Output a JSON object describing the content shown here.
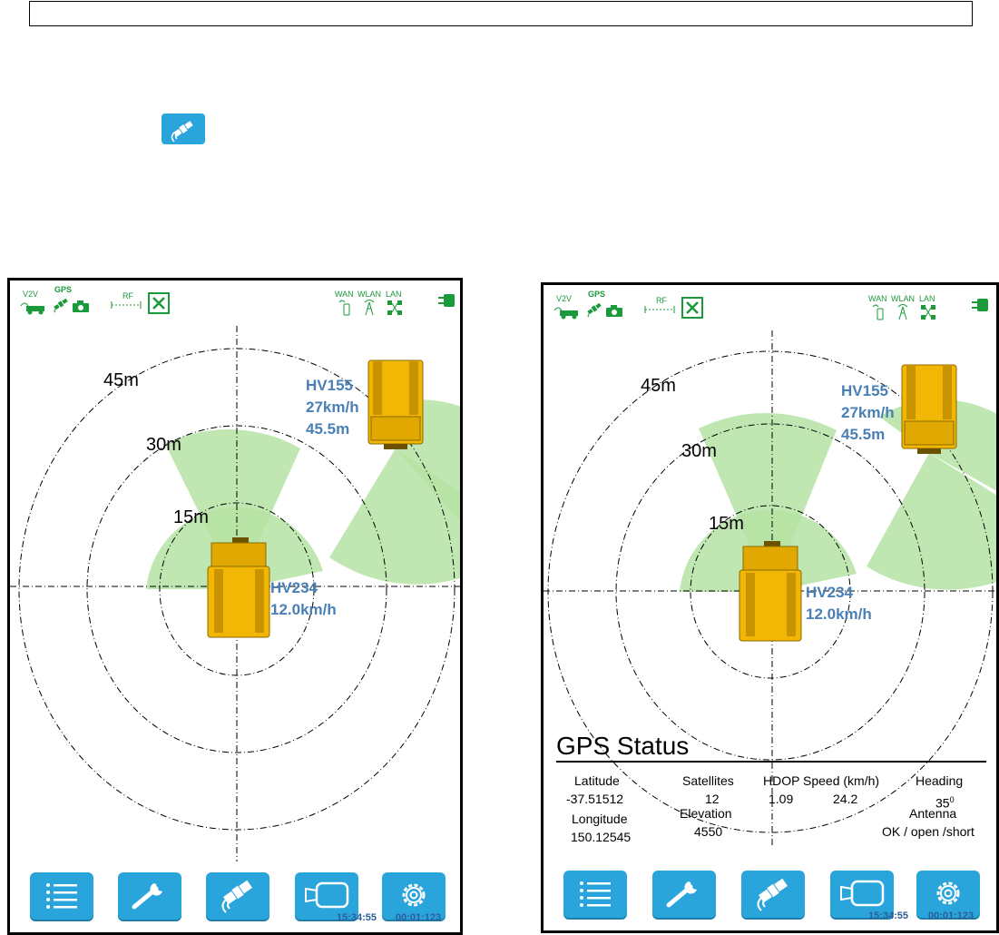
{
  "screens": [
    {
      "status": {
        "v2v": "V2V",
        "gps": "GPS",
        "rf": "RF",
        "wan": "WAN",
        "wlan": "WLAN",
        "lan": "LAN"
      },
      "rings": [
        "45m",
        "30m",
        "15m"
      ],
      "vehicles": [
        {
          "id": "HV155",
          "speed": "27km/h",
          "distance": "45.5m"
        },
        {
          "id": "HV234",
          "speed": "12.0km/h"
        }
      ],
      "footer": {
        "clock": "15:34:55",
        "timer": "00:01:123"
      }
    },
    {
      "status": {
        "v2v": "V2V",
        "gps": "GPS",
        "rf": "RF",
        "wan": "WAN",
        "wlan": "WLAN",
        "lan": "LAN"
      },
      "rings": [
        "45m",
        "30m",
        "15m"
      ],
      "vehicles": [
        {
          "id": "HV155",
          "speed": "27km/h",
          "distance": "45.5m"
        },
        {
          "id": "HV234",
          "speed": "12.0km/h"
        }
      ],
      "gps_status": {
        "title": "GPS Status",
        "latitude_label": "Latitude",
        "latitude_value": "-37.51512",
        "longitude_label": "Longitude",
        "longitude_value": "150.12545",
        "satellites_label": "Satellites",
        "satellites_value": "12",
        "elevation_label": "Elevation",
        "elevation_value": "4550",
        "hdop_label": "HDOP",
        "hdop_value": "1.09",
        "speed_label": "Speed (km/h)",
        "speed_value": "24.2",
        "heading_label": "Heading",
        "heading_value": "35",
        "antenna_label": "Antenna",
        "antenna_value": "OK / open /short"
      },
      "footer": {
        "clock": "15:34:55",
        "timer": "00:01:123"
      }
    }
  ],
  "colors": {
    "accent": "#29a5dc",
    "status_green": "#1a9a3a",
    "label_blue": "#4a7fb5",
    "zone_green": "#b5e3a3",
    "truck_yellow": "#f2b705"
  },
  "buttons": [
    "list-icon",
    "wrench-icon",
    "satellite-icon",
    "camera-icon",
    "gear-icon"
  ]
}
